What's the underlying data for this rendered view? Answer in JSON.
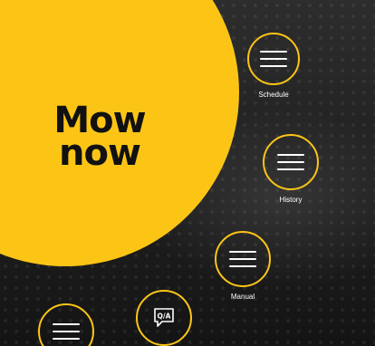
{
  "mow_button": {
    "line1": "Mow",
    "line2": "now"
  },
  "menu": {
    "schedule": "Schedule",
    "history": "History",
    "manual": "Manual",
    "qa": "Q/A"
  },
  "colors": {
    "accent": "#fcc516",
    "background": "#1f1f1f",
    "text": "#ffffff"
  },
  "icons": {
    "menu_lines": "menu-lines-icon",
    "qa": "chat-bubble-icon"
  }
}
